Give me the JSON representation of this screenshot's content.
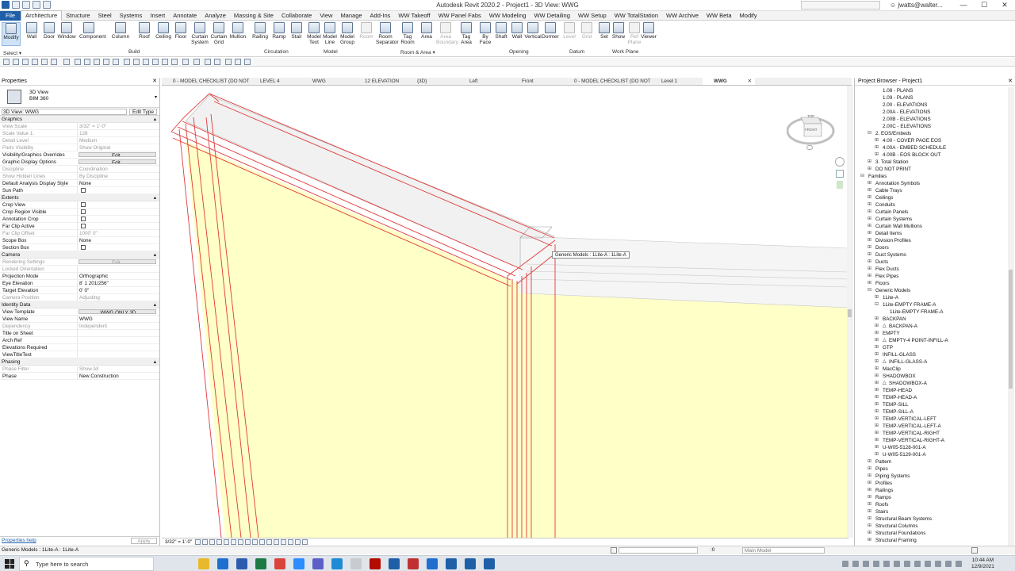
{
  "app": {
    "title": "Autodesk Revit 2020.2 - Project1 - 3D View: WWG",
    "user": "jwatts@walter...",
    "window_controls": [
      "—",
      "☐",
      "✕"
    ]
  },
  "ribbon_tabs": [
    "File",
    "Architecture",
    "Structure",
    "Steel",
    "Systems",
    "Insert",
    "Annotate",
    "Analyze",
    "Massing & Site",
    "Collaborate",
    "View",
    "Manage",
    "Add-Ins",
    "WW Takeoff",
    "WW Panel Fabs",
    "WW Modeling",
    "WW Detailing",
    "WW Setup",
    "WW TotalStation",
    "WW Archive",
    "WW Beta",
    "Modify"
  ],
  "ribbon_buttons": [
    {
      "label": "Modify"
    },
    {
      "label": "Wall"
    },
    {
      "label": "Door"
    },
    {
      "label": "Window"
    },
    {
      "label": "Component"
    },
    {
      "label": "Column"
    },
    {
      "label": "Roof"
    },
    {
      "label": "Ceiling"
    },
    {
      "label": "Floor"
    },
    {
      "label": "Curtain\nSystem"
    },
    {
      "label": "Curtain\nGrid"
    },
    {
      "label": "Mullion"
    },
    {
      "label": "Railing"
    },
    {
      "label": "Ramp"
    },
    {
      "label": "Stair"
    },
    {
      "label": "Model\nText"
    },
    {
      "label": "Model\nLine"
    },
    {
      "label": "Model\nGroup"
    },
    {
      "label": "Room"
    },
    {
      "label": "Room\nSeparator"
    },
    {
      "label": "Tag\nRoom"
    },
    {
      "label": "Area"
    },
    {
      "label": "Area\nBoundary"
    },
    {
      "label": "Tag\nArea"
    },
    {
      "label": "By\nFace"
    },
    {
      "label": "Shaft"
    },
    {
      "label": "Wall"
    },
    {
      "label": "Vertical"
    },
    {
      "label": "Dormer"
    },
    {
      "label": "Level"
    },
    {
      "label": "Grid"
    },
    {
      "label": "Set"
    },
    {
      "label": "Show"
    },
    {
      "label": "Ref\nPlane"
    },
    {
      "label": "Viewer"
    }
  ],
  "ribbon_panels": [
    "Build",
    "Circulation",
    "Model",
    "Room & Area ▾",
    "Opening",
    "Datum",
    "Work Plane"
  ],
  "select_label": "Select ▾",
  "properties": {
    "title": "Properties",
    "type_name": "3D View",
    "type_sub": "BIM 360",
    "view_selector": "3D View: WWG",
    "edit_type": "Edit Type",
    "groups": [
      {
        "name": "Graphics",
        "rows": [
          {
            "k": "View Scale",
            "v": "3/32\" = 1'-0\"",
            "dim": true
          },
          {
            "k": "Scale Value    1:",
            "v": "128",
            "dim": true
          },
          {
            "k": "Detail Level",
            "v": "Medium",
            "dim": true
          },
          {
            "k": "Parts Visibility",
            "v": "Show Original",
            "dim": true
          },
          {
            "k": "Visibility/Graphics Overrides",
            "v": "Edit...",
            "btn": true
          },
          {
            "k": "Graphic Display Options",
            "v": "Edit...",
            "btn": true
          },
          {
            "k": "Discipline",
            "v": "Coordination",
            "dim": true
          },
          {
            "k": "Show Hidden Lines",
            "v": "By Discipline",
            "dim": true
          },
          {
            "k": "Default Analysis Display Style",
            "v": "None"
          },
          {
            "k": "Sun Path",
            "v": "",
            "cb": true
          }
        ]
      },
      {
        "name": "Extents",
        "rows": [
          {
            "k": "Crop View",
            "v": "",
            "cb": true
          },
          {
            "k": "Crop Region Visible",
            "v": "",
            "cb": true
          },
          {
            "k": "Annotation Crop",
            "v": "",
            "cb": true
          },
          {
            "k": "Far Clip Active",
            "v": "",
            "cb": true
          },
          {
            "k": "Far Clip Offset",
            "v": "1000' 0\"",
            "dim": true
          },
          {
            "k": "Scope Box",
            "v": "None"
          },
          {
            "k": "Section Box",
            "v": "",
            "cb": true
          }
        ]
      },
      {
        "name": "Camera",
        "rows": [
          {
            "k": "Rendering Settings",
            "v": "Edit...",
            "btn": true,
            "dim": true
          },
          {
            "k": "Locked Orientation",
            "v": "",
            "dim": true
          },
          {
            "k": "Projection Mode",
            "v": "Orthographic"
          },
          {
            "k": "Eye Elevation",
            "v": "8' 1 201/256\""
          },
          {
            "k": "Target Elevation",
            "v": "0' 0\""
          },
          {
            "k": "Camera Position",
            "v": "Adjusting",
            "dim": true
          }
        ]
      },
      {
        "name": "Identity Data",
        "rows": [
          {
            "k": "View Template",
            "v": "WWG ONLY 3D",
            "btn": true
          },
          {
            "k": "View Name",
            "v": "WWG"
          },
          {
            "k": "Dependency",
            "v": "Independent",
            "dim": true
          },
          {
            "k": "Title on Sheet",
            "v": ""
          },
          {
            "k": "Arch Ref",
            "v": ""
          },
          {
            "k": "Elevations Required",
            "v": ""
          },
          {
            "k": "ViewTitleText",
            "v": ""
          }
        ]
      },
      {
        "name": "Phasing",
        "rows": [
          {
            "k": "Phase Filter",
            "v": "Show All",
            "dim": true
          },
          {
            "k": "Phase",
            "v": "New Construction"
          }
        ]
      }
    ],
    "help": "Properties help",
    "apply": "Apply"
  },
  "view_tabs": [
    {
      "label": "0 - MODEL CHECKLIST (DO NOT PR...",
      "wide": true
    },
    {
      "label": "LEVEL 4"
    },
    {
      "label": "WWG"
    },
    {
      "label": "12 ELEVATION"
    },
    {
      "label": "{3D}"
    },
    {
      "label": "Left"
    },
    {
      "label": "Front"
    },
    {
      "label": "0 - MODEL CHECKLIST (DO NOT PR...",
      "wide": true
    },
    {
      "label": "Level 1"
    },
    {
      "label": "WWG",
      "active": true
    }
  ],
  "tooltip": "Generic Models : 1Lite-A : 1Lite-A",
  "navcube": {
    "top": "TOP",
    "front": "FRONT"
  },
  "view_scale": "3/32\" = 1'-0\"",
  "browser": {
    "title": "Project Browser - Project1",
    "items": [
      {
        "t": "1.08 - PLANS",
        "i": 3
      },
      {
        "t": "1.09 - PLANS",
        "i": 3
      },
      {
        "t": "2.00 - ELEVATIONS",
        "i": 3
      },
      {
        "t": "2.00A - ELEVATIONS",
        "i": 3
      },
      {
        "t": "2.00B - ELEVATIONS",
        "i": 3
      },
      {
        "t": "2.00C - ELEVATIONS",
        "i": 3
      },
      {
        "t": "2. EOS/Embeds",
        "i": 2,
        "tg": "⊟"
      },
      {
        "t": "4.00 - COVER PAGE EOS",
        "i": 3,
        "tg": "⊞"
      },
      {
        "t": "4.00A - EMBED SCHEDULE",
        "i": 3,
        "tg": "⊞"
      },
      {
        "t": "4.00B - EOS BLOCK OUT",
        "i": 3,
        "tg": "⊞"
      },
      {
        "t": "3. Total Station",
        "i": 2,
        "tg": "⊞"
      },
      {
        "t": "DO NOT PRINT",
        "i": 2,
        "tg": "⊞"
      },
      {
        "t": "Families",
        "i": 1,
        "tg": "⊟"
      },
      {
        "t": "Annotation Symbols",
        "i": 2,
        "tg": "⊞"
      },
      {
        "t": "Cable Trays",
        "i": 2,
        "tg": "⊞"
      },
      {
        "t": "Ceilings",
        "i": 2,
        "tg": "⊞"
      },
      {
        "t": "Conduits",
        "i": 2,
        "tg": "⊞"
      },
      {
        "t": "Curtain Panels",
        "i": 2,
        "tg": "⊞"
      },
      {
        "t": "Curtain Systems",
        "i": 2,
        "tg": "⊞"
      },
      {
        "t": "Curtain Wall Mullions",
        "i": 2,
        "tg": "⊞"
      },
      {
        "t": "Detail Items",
        "i": 2,
        "tg": "⊞"
      },
      {
        "t": "Division Profiles",
        "i": 2,
        "tg": "⊞"
      },
      {
        "t": "Doors",
        "i": 2,
        "tg": "⊞"
      },
      {
        "t": "Duct Systems",
        "i": 2,
        "tg": "⊞"
      },
      {
        "t": "Ducts",
        "i": 2,
        "tg": "⊞"
      },
      {
        "t": "Flex Ducts",
        "i": 2,
        "tg": "⊞"
      },
      {
        "t": "Flex Pipes",
        "i": 2,
        "tg": "⊞"
      },
      {
        "t": "Floors",
        "i": 2,
        "tg": "⊞"
      },
      {
        "t": "Generic Models",
        "i": 2,
        "tg": "⊟"
      },
      {
        "t": "1Lite-A",
        "i": 3,
        "tg": "⊞"
      },
      {
        "t": "1Lite-EMPTY FRAME-A",
        "i": 3,
        "tg": "⊟"
      },
      {
        "t": "1Lite-EMPTY FRAME-A",
        "i": 4
      },
      {
        "t": "BACKPAN",
        "i": 3,
        "tg": "⊞"
      },
      {
        "t": "BACKPAN-A",
        "i": 3,
        "tg": "⊞",
        "fam": true
      },
      {
        "t": "EMPTY",
        "i": 3,
        "tg": "⊞"
      },
      {
        "t": "EMPTY-4 POINT-INFILL-A",
        "i": 3,
        "tg": "⊞",
        "fam": true
      },
      {
        "t": "GTP",
        "i": 3,
        "tg": "⊞"
      },
      {
        "t": "INFILL-GLASS",
        "i": 3,
        "tg": "⊞"
      },
      {
        "t": "INFILL-GLASS-A",
        "i": 3,
        "tg": "⊞",
        "fam": true
      },
      {
        "t": "MacClip",
        "i": 3,
        "tg": "⊞"
      },
      {
        "t": "SHADOWBOX",
        "i": 3,
        "tg": "⊞"
      },
      {
        "t": "SHADOWBOX-A",
        "i": 3,
        "tg": "⊞",
        "fam": true
      },
      {
        "t": "TEMP-HEAD",
        "i": 3,
        "tg": "⊞"
      },
      {
        "t": "TEMP-HEAD-A",
        "i": 3,
        "tg": "⊞"
      },
      {
        "t": "TEMP-SILL",
        "i": 3,
        "tg": "⊞"
      },
      {
        "t": "TEMP-SILL-A",
        "i": 3,
        "tg": "⊞"
      },
      {
        "t": "TEMP-VERTICAL-LEFT",
        "i": 3,
        "tg": "⊞"
      },
      {
        "t": "TEMP-VERTICAL-LEFT-A",
        "i": 3,
        "tg": "⊞"
      },
      {
        "t": "TEMP-VERTICAL-RIGHT",
        "i": 3,
        "tg": "⊞"
      },
      {
        "t": "TEMP-VERTICAL-RIGHT-A",
        "i": 3,
        "tg": "⊞"
      },
      {
        "t": "U-W05-5128-001-A",
        "i": 3,
        "tg": "⊞"
      },
      {
        "t": "U-W05-5129-001-A",
        "i": 3,
        "tg": "⊞"
      },
      {
        "t": "Pattern",
        "i": 2,
        "tg": "⊞"
      },
      {
        "t": "Pipes",
        "i": 2,
        "tg": "⊞"
      },
      {
        "t": "Piping Systems",
        "i": 2,
        "tg": "⊞"
      },
      {
        "t": "Profiles",
        "i": 2,
        "tg": "⊞"
      },
      {
        "t": "Railings",
        "i": 2,
        "tg": "⊞"
      },
      {
        "t": "Ramps",
        "i": 2,
        "tg": "⊞"
      },
      {
        "t": "Roofs",
        "i": 2,
        "tg": "⊞"
      },
      {
        "t": "Stairs",
        "i": 2,
        "tg": "⊞"
      },
      {
        "t": "Structural Beam Systems",
        "i": 2,
        "tg": "⊞"
      },
      {
        "t": "Structural Columns",
        "i": 2,
        "tg": "⊞"
      },
      {
        "t": "Structural Foundations",
        "i": 2,
        "tg": "⊞"
      },
      {
        "t": "Structural Framing",
        "i": 2,
        "tg": "⊞"
      }
    ]
  },
  "status": {
    "text": "Generic Models : 1Lite-A : 1Lite-A",
    "zero": ":0",
    "model": "Main Model"
  },
  "taskbar": {
    "search": "Type here to search",
    "time": "10:44 AM",
    "date": "12/9/2021"
  },
  "colors": {
    "file_tab": "#1f5fa8",
    "wall_fill": "#ffffc8",
    "frame_line": "#e03a3a"
  }
}
